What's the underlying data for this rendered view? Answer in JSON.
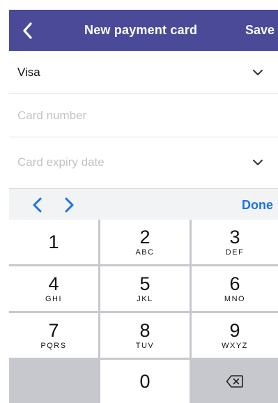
{
  "nav": {
    "back_icon": "chevron-left-icon",
    "title": "New payment card",
    "save_label": "Save",
    "background": "#4a4a99"
  },
  "form": {
    "card_type": {
      "value": "Visa",
      "icon": "chevron-down-icon"
    },
    "card_number": {
      "placeholder": "Card number"
    },
    "expiry": {
      "placeholder": "Card expiry date",
      "icon": "chevron-down-icon"
    }
  },
  "accessory": {
    "prev_icon": "chevron-left-icon",
    "next_icon": "chevron-right-icon",
    "done_label": "Done",
    "accent": "#1a73e8"
  },
  "keypad": {
    "keys": [
      {
        "digit": "1",
        "letters": ""
      },
      {
        "digit": "2",
        "letters": "ABC"
      },
      {
        "digit": "3",
        "letters": "DEF"
      },
      {
        "digit": "4",
        "letters": "GHI"
      },
      {
        "digit": "5",
        "letters": "JKL"
      },
      {
        "digit": "6",
        "letters": "MNO"
      },
      {
        "digit": "7",
        "letters": "PQRS"
      },
      {
        "digit": "8",
        "letters": "TUV"
      },
      {
        "digit": "9",
        "letters": "WXYZ"
      },
      {
        "digit": "0",
        "letters": ""
      }
    ],
    "delete_icon": "backspace-icon"
  }
}
